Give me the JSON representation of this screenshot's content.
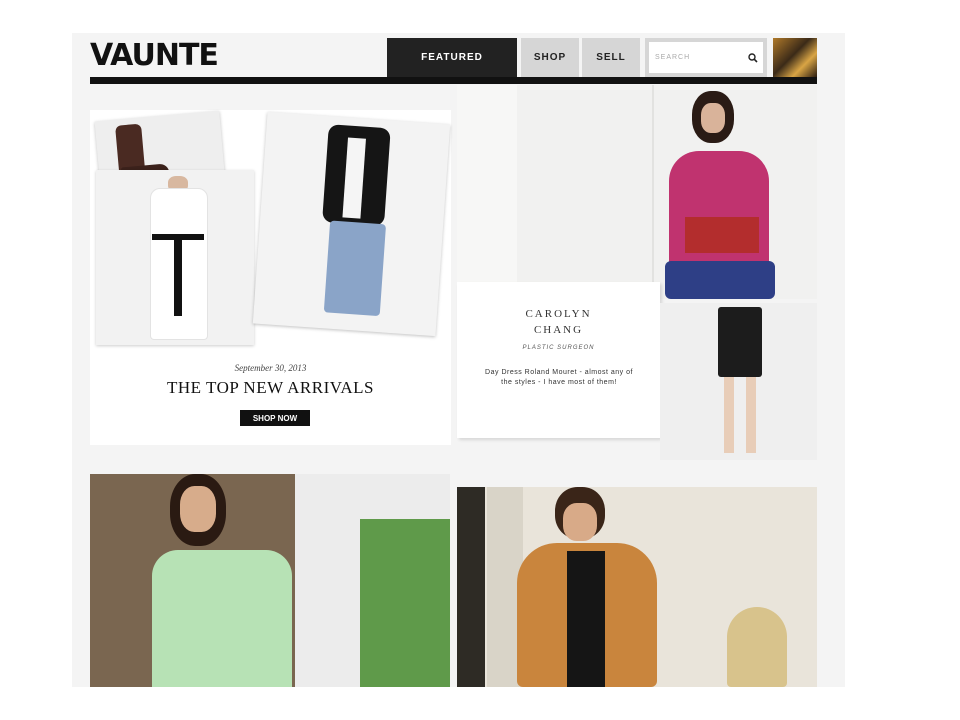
{
  "brand": {
    "name": "VAUNTE"
  },
  "nav": {
    "featured": "FEATURED",
    "shop": "SHOP",
    "sell": "SELL",
    "search_placeholder": "SEARCH"
  },
  "cards": {
    "arrivals": {
      "date": "September 30, 2013",
      "title": "THE TOP NEW ARRIVALS",
      "button": "SHOP NOW"
    },
    "profile": {
      "name_line1": "CAROLYN",
      "name_line2": "CHANG",
      "role": "PLASTIC SURGEON",
      "quote": "Day Dress Roland Mouret - almost any of the styles - I have most of them!"
    }
  },
  "colors": {
    "header_bar": "#111111",
    "nav_active": "#222222",
    "nav_inactive": "#d6d6d6"
  },
  "icons": [
    "search-icon"
  ]
}
